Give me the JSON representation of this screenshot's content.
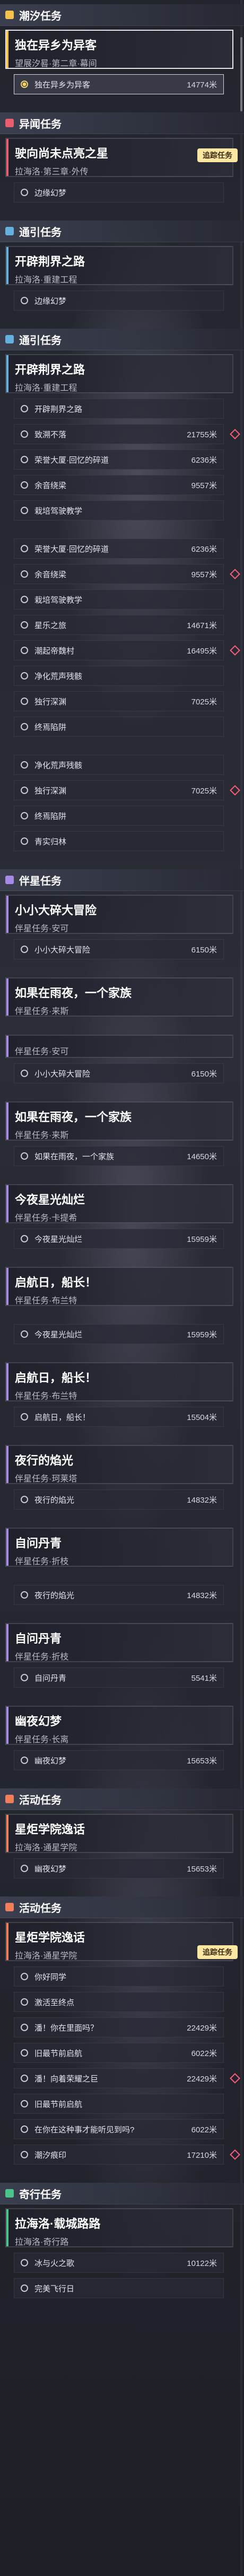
{
  "colors": {
    "tide": "#f2c14e",
    "strange": "#e85d6f",
    "pass": "#66b0e0",
    "companion": "#a58be6",
    "activity": "#f07e5a",
    "trail": "#4cc38a"
  },
  "track_button": "追踪任务",
  "track_button2": "追踪任务",
  "sections": [
    {
      "cat": "潮汐任务",
      "color": "tide",
      "quest": "独在异乡为异客",
      "sub": "望展汐晷·第二章·幕间",
      "objs": [
        {
          "t": "独在异乡为异客",
          "d": "14774米",
          "on": true,
          "hl": true
        }
      ]
    },
    {
      "cat": "异闻任务",
      "color": "strange",
      "quest": "驶向尚未点亮之星",
      "sub": "拉海洛·第三章·外传",
      "objs": [
        {
          "t": "边缘幻梦",
          "d": ""
        }
      ]
    },
    {
      "cat": "通引任务",
      "color": "pass",
      "quest": "开辟荆界之路",
      "sub": "拉海洛·重建工程",
      "objs": [
        {
          "t": "边缘幻梦",
          "d": ""
        }
      ]
    },
    {
      "cat": "通引任务",
      "color": "pass",
      "quest": "开辟荆界之路",
      "sub": "拉海洛·重建工程",
      "objs": [
        {
          "t": "开辟荆界之路",
          "d": ""
        },
        {
          "t": "致溯不落",
          "d": "21755米"
        },
        {
          "t": "荣誉大厦·回忆的碎道",
          "d": "6236米"
        },
        {
          "t": "余音绕梁",
          "d": "9557米"
        },
        {
          "t": "栽培驾驶教学",
          "d": ""
        }
      ]
    },
    {
      "cat": "",
      "color": "pass",
      "quest": "",
      "sub": "",
      "objs": [
        {
          "t": "荣誉大厦·回忆的碎道",
          "d": "6236米"
        },
        {
          "t": "余音绕梁",
          "d": "9557米"
        },
        {
          "t": "栽培驾驶教学",
          "d": ""
        },
        {
          "t": "星乐之旅",
          "d": "14671米"
        },
        {
          "t": "潮起帝魏村",
          "d": "16495米"
        },
        {
          "t": "净化荒声残骸",
          "d": ""
        },
        {
          "t": "独行深渊",
          "d": "7025米"
        },
        {
          "t": "终焉陷阱",
          "d": ""
        }
      ]
    },
    {
      "cat": "",
      "color": "pass",
      "quest": "",
      "sub": "",
      "objs": [
        {
          "t": "净化荒声残骸",
          "d": ""
        },
        {
          "t": "独行深渊",
          "d": "7025米"
        },
        {
          "t": "终焉陷阱",
          "d": ""
        },
        {
          "t": "青实归林",
          "d": ""
        }
      ]
    },
    {
      "cat": "伴星任务",
      "color": "companion",
      "quest": "小小大碎大冒险",
      "sub": "伴星任务·安可",
      "objs": [
        {
          "t": "小小大碎大冒险",
          "d": "6150米"
        }
      ]
    },
    {
      "cat": "",
      "color": "companion",
      "quest": "如果在雨夜，一个家族",
      "sub": "伴星任务·来斯",
      "objs": []
    },
    {
      "cat": "",
      "color": "companion",
      "quest": "",
      "sub": "伴星任务·安可",
      "objs": [
        {
          "t": "小小大碎大冒险",
          "d": "6150米"
        }
      ]
    },
    {
      "cat": "",
      "color": "companion",
      "quest": "如果在雨夜，一个家族",
      "sub": "伴星任务·来斯",
      "objs": [
        {
          "t": "如果在雨夜，一个家族",
          "d": "14650米"
        }
      ]
    },
    {
      "cat": "",
      "color": "companion",
      "quest": "今夜星光灿烂",
      "sub": "伴星任务·卡提希",
      "objs": [
        {
          "t": "今夜星光灿烂",
          "d": "15959米"
        }
      ]
    },
    {
      "cat": "",
      "color": "companion",
      "quest": "启航日，船长！",
      "sub": "伴星任务·布兰特",
      "objs": []
    },
    {
      "cat": "",
      "color": "companion",
      "quest": "",
      "sub": "",
      "objs": [
        {
          "t": "今夜星光灿烂",
          "d": "15959米"
        }
      ]
    },
    {
      "cat": "",
      "color": "companion",
      "quest": "启航日，船长！",
      "sub": "伴星任务·布兰特",
      "objs": [
        {
          "t": "启航日，船长！",
          "d": "15504米"
        }
      ]
    },
    {
      "cat": "",
      "color": "companion",
      "quest": "夜行的焰光",
      "sub": "伴星任务·珂莱塔",
      "objs": [
        {
          "t": "夜行的焰光",
          "d": "14832米"
        }
      ]
    },
    {
      "cat": "",
      "color": "companion",
      "quest": "自问丹青",
      "sub": "伴星任务·折枝",
      "objs": []
    },
    {
      "cat": "",
      "color": "companion",
      "quest": "",
      "sub": "",
      "objs": [
        {
          "t": "夜行的焰光",
          "d": "14832米"
        }
      ]
    },
    {
      "cat": "",
      "color": "companion",
      "quest": "自问丹青",
      "sub": "伴星任务·折枝",
      "objs": [
        {
          "t": "自问丹青",
          "d": "5541米"
        }
      ]
    },
    {
      "cat": "",
      "color": "companion",
      "quest": "幽夜幻梦",
      "sub": "伴星任务·长离",
      "objs": [
        {
          "t": "幽夜幻梦",
          "d": "15653米"
        }
      ]
    },
    {
      "cat": "活动任务",
      "color": "activity",
      "quest": "星炬学院逸话",
      "sub": "拉海洛·通星学院",
      "objs": [
        {
          "t": "幽夜幻梦",
          "d": "15653米"
        }
      ]
    },
    {
      "cat": "活动任务",
      "color": "activity",
      "quest": "星炬学院逸话",
      "sub": "拉海洛·通星学院",
      "objs": [
        {
          "t": "你好同学",
          "d": ""
        },
        {
          "t": "激活至终点",
          "d": ""
        },
        {
          "t": "潘！你在里面吗？",
          "d": "22429米"
        },
        {
          "t": "旧最节前启航",
          "d": "6022米"
        },
        {
          "t": "潘！向着荣耀之巨",
          "d": "22429米"
        },
        {
          "t": "旧最节前启航",
          "d": ""
        },
        {
          "t": "在你在这种事才能听见到吗?",
          "d": "6022米"
        },
        {
          "t": "潮汐痕印",
          "d": "17210米"
        }
      ]
    },
    {
      "cat": "奇行任务",
      "color": "trail",
      "quest": "拉海洛·载城路路",
      "sub": "拉海洛·奇行路",
      "objs": [
        {
          "t": "冰与火之歌",
          "d": "10122米"
        },
        {
          "t": "完美飞行日",
          "d": ""
        }
      ]
    }
  ]
}
